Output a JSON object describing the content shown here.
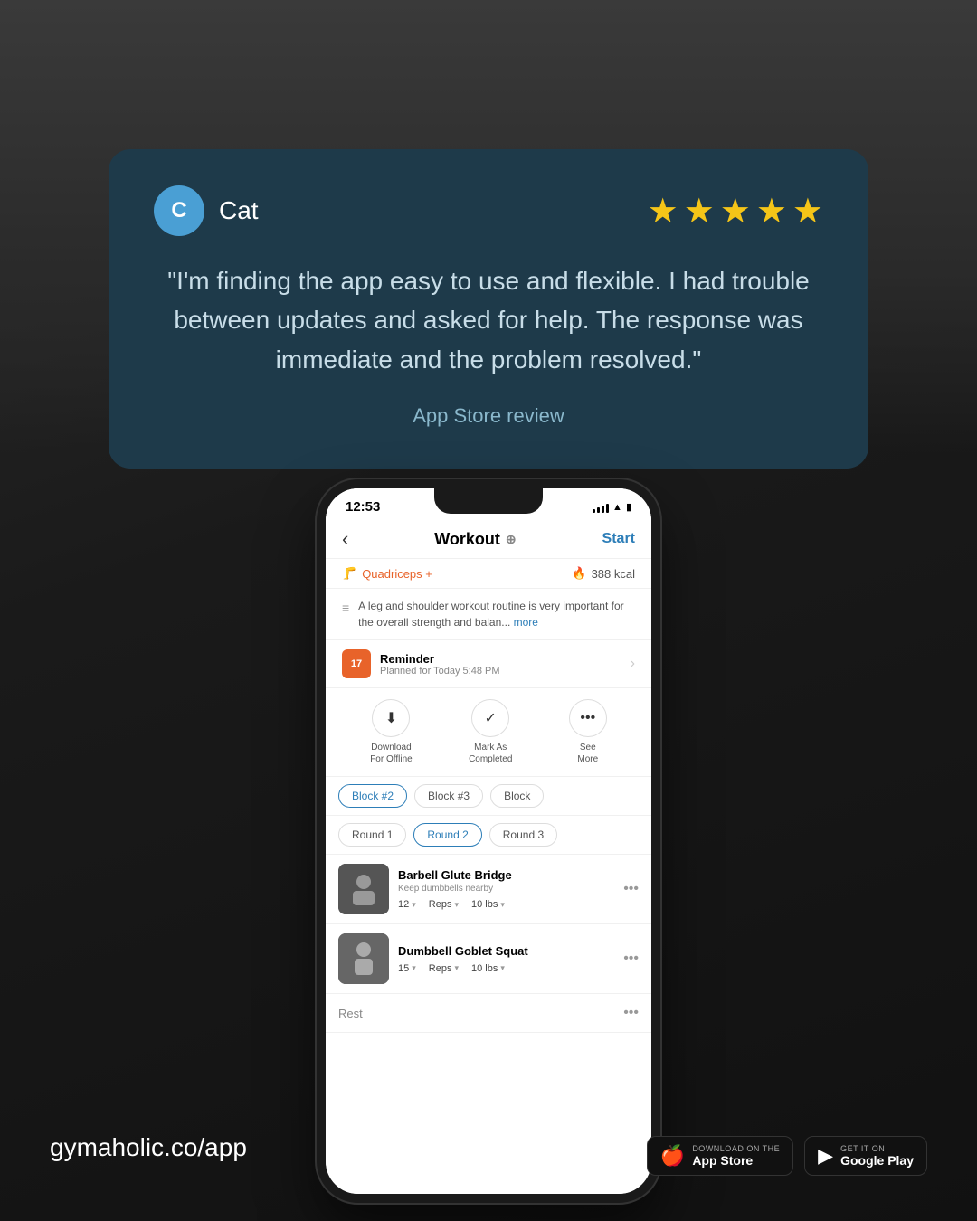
{
  "page": {
    "background_color": "#1a1a1a",
    "website": "gymaholic.co/app"
  },
  "review_card": {
    "avatar_letter": "C",
    "avatar_color": "#4a9fd4",
    "reviewer_name": "Cat",
    "stars": 5,
    "quote": "\"I'm finding the app easy to use and flexible. I had trouble between updates and asked for help. The response was immediate and the problem resolved.\"",
    "source": "App Store review"
  },
  "phone": {
    "status_bar": {
      "time": "12:53",
      "location_icon": "◀"
    },
    "nav": {
      "back_icon": "‹",
      "title": "Workout",
      "pin_icon": "⊕",
      "start_label": "Start"
    },
    "workout_meta": {
      "tag": "Quadriceps +",
      "kcal": "388 kcal"
    },
    "description": {
      "text": "A leg and shoulder workout routine is very important for the overall strength and balan...",
      "more_link": "more"
    },
    "reminder": {
      "day": "17",
      "title": "Reminder",
      "subtitle": "Planned for Today 5:48 PM"
    },
    "actions": [
      {
        "icon": "⬇",
        "label": "Download\nFor Offline"
      },
      {
        "icon": "✓",
        "label": "Mark As\nCompleted"
      },
      {
        "icon": "•••",
        "label": "See\nMore"
      }
    ],
    "block_tabs": [
      {
        "label": "Block #2",
        "active": false
      },
      {
        "label": "Block #3",
        "active": false
      },
      {
        "label": "Block",
        "active": false,
        "partial": true
      }
    ],
    "round_tabs": [
      {
        "label": "Round 1",
        "active": false
      },
      {
        "label": "Round 2",
        "active": true
      },
      {
        "label": "Round 3",
        "active": false
      }
    ],
    "exercises": [
      {
        "name": "Barbell Glute Bridge",
        "note": "Keep dumbbells nearby",
        "reps": "12",
        "unit": "Reps",
        "weight": "10 lbs"
      },
      {
        "name": "Dumbbell Goblet Squat",
        "note": "",
        "reps": "15",
        "unit": "Reps",
        "weight": "10 lbs"
      }
    ],
    "rest_label": "Rest"
  },
  "store_badges": [
    {
      "icon": "🍎",
      "sub": "Download on the",
      "name": "App Store"
    },
    {
      "icon": "▶",
      "sub": "GET IT ON",
      "name": "Google Play"
    }
  ]
}
